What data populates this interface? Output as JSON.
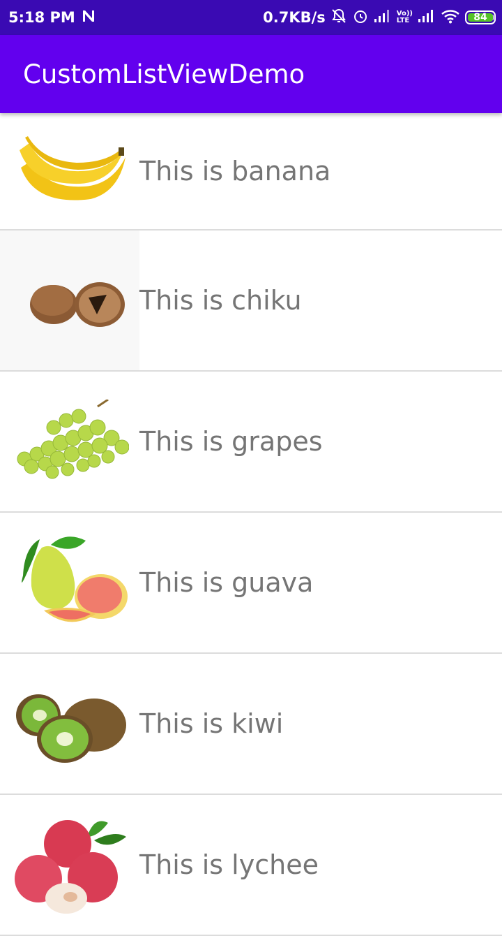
{
  "status_bar": {
    "time": "5:18 PM",
    "speed": "0.7KB/s",
    "battery": "84",
    "lte": "LTE",
    "volte": "Vo))"
  },
  "app_bar": {
    "title": "CustomListViewDemo"
  },
  "items": [
    {
      "label": "This is banana",
      "icon": "banana-image"
    },
    {
      "label": "This is chiku",
      "icon": "chiku-image"
    },
    {
      "label": "This is grapes",
      "icon": "grapes-image"
    },
    {
      "label": "This is guava",
      "icon": "guava-image"
    },
    {
      "label": "This is kiwi",
      "icon": "kiwi-image"
    },
    {
      "label": "This is lychee",
      "icon": "lychee-image"
    }
  ],
  "colors": {
    "status_bar": "#3a0ab3",
    "app_bar": "#6200ee",
    "text": "#757575",
    "divider": "#dcdcdc"
  }
}
